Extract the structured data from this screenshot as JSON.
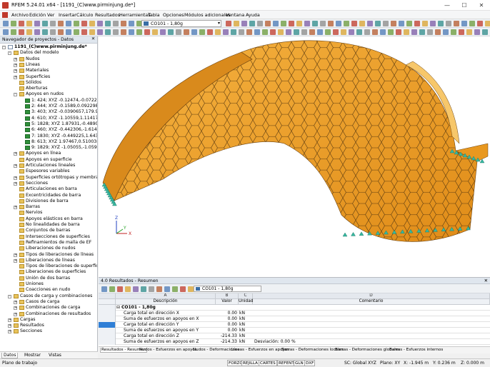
{
  "window": {
    "title": "RFEM 5.24.01 x64 - [1191_(C)www.pirminjung.de*]",
    "minimize": "—",
    "maximize": "☐",
    "close": "✕"
  },
  "menu": [
    "Archivo",
    "Edición",
    "Ver",
    "Insertar",
    "Cálculo",
    "Resultados",
    "Herramientas",
    "Tabla",
    "Opciones",
    "Módulos adicionales",
    "Ventana",
    "Ayuda"
  ],
  "toolbar": {
    "load_case": "CO101 - 1,80g"
  },
  "navigator": {
    "title": "Navegador de proyectos - Datos",
    "items": [
      {
        "label": "1191_(C)www.pirminjung.de*",
        "level": 0,
        "exp": "−",
        "icon": "file",
        "bold": true
      },
      {
        "label": "Datos del modelo",
        "level": 1,
        "exp": "−",
        "icon": "fold"
      },
      {
        "label": "Nudos",
        "level": 2,
        "exp": "+",
        "icon": "fold"
      },
      {
        "label": "Líneas",
        "level": 2,
        "exp": "+",
        "icon": "fold"
      },
      {
        "label": "Materiales",
        "level": 2,
        "exp": "+",
        "icon": "fold"
      },
      {
        "label": "Superficies",
        "level": 2,
        "exp": "+",
        "icon": "fold"
      },
      {
        "label": "Sólidos",
        "level": 2,
        "exp": "",
        "icon": "fold"
      },
      {
        "label": "Aberturas",
        "level": 2,
        "exp": "",
        "icon": "fold"
      },
      {
        "label": "Apoyos en nudos",
        "level": 2,
        "exp": "−",
        "icon": "fold"
      },
      {
        "label": "1: 424; XYZ -0.12474,-0.072279",
        "level": 3,
        "exp": "",
        "icon": "sup"
      },
      {
        "label": "2: 444; XYZ -0.1589,0.0922984,5",
        "level": 3,
        "exp": "",
        "icon": "sup"
      },
      {
        "label": "3: 403; XYZ -0.0390657,179.956 *",
        "level": 3,
        "exp": "",
        "icon": "sup"
      },
      {
        "label": "4: 610; XYZ -1.10559,1.11417,44",
        "level": 3,
        "exp": "",
        "icon": "sup"
      },
      {
        "label": "5: 1828; XYZ 1.87931,-0.489018,",
        "level": 3,
        "exp": "",
        "icon": "sup"
      },
      {
        "label": "6: 460; XYZ -0.442306,-1.61422,",
        "level": 3,
        "exp": "",
        "icon": "sup"
      },
      {
        "label": "7: 1830; XYZ -0.449225,1.64378,",
        "level": 3,
        "exp": "",
        "icon": "sup"
      },
      {
        "label": "8: 613; XYZ 1.97467,0.510038,-7",
        "level": 3,
        "exp": "",
        "icon": "sup"
      },
      {
        "label": "9: 1829; XYZ -1.05055,-1.05909,",
        "level": 3,
        "exp": "",
        "icon": "sup"
      },
      {
        "label": "Apoyos en línea",
        "level": 2,
        "exp": "+",
        "icon": "fold"
      },
      {
        "label": "Apoyos en superficie",
        "level": 2,
        "exp": "",
        "icon": "fold"
      },
      {
        "label": "Articulaciones lineales",
        "level": 2,
        "exp": "+",
        "icon": "fold"
      },
      {
        "label": "Espesores variables",
        "level": 2,
        "exp": "",
        "icon": "fold"
      },
      {
        "label": "Superficies ortótropas y membran",
        "level": 2,
        "exp": "+",
        "icon": "fold"
      },
      {
        "label": "Secciones",
        "level": 2,
        "exp": "+",
        "icon": "fold"
      },
      {
        "label": "Articulaciones en barra",
        "level": 2,
        "exp": "",
        "icon": "fold"
      },
      {
        "label": "Excentricidades de barra",
        "level": 2,
        "exp": "",
        "icon": "fold"
      },
      {
        "label": "Divisiones de barra",
        "level": 2,
        "exp": "",
        "icon": "fold"
      },
      {
        "label": "Barras",
        "level": 2,
        "exp": "+",
        "icon": "fold"
      },
      {
        "label": "Nervios",
        "level": 2,
        "exp": "",
        "icon": "fold"
      },
      {
        "label": "Apoyos elásticos en barra",
        "level": 2,
        "exp": "",
        "icon": "fold"
      },
      {
        "label": "No linealidades de barra",
        "level": 2,
        "exp": "",
        "icon": "fold"
      },
      {
        "label": "Conjuntos de barras",
        "level": 2,
        "exp": "",
        "icon": "fold"
      },
      {
        "label": "Intersecciones de superficies",
        "level": 2,
        "exp": "",
        "icon": "fold"
      },
      {
        "label": "Refinamientos de malla de EF",
        "level": 2,
        "exp": "",
        "icon": "fold"
      },
      {
        "label": "Liberaciones de nudos",
        "level": 2,
        "exp": "",
        "icon": "fold"
      },
      {
        "label": "Tipos de liberaciones de líneas",
        "level": 2,
        "exp": "+",
        "icon": "fold"
      },
      {
        "label": "Liberaciones de líneas",
        "level": 2,
        "exp": "+",
        "icon": "fold"
      },
      {
        "label": "Tipos de liberaciones de superficie",
        "level": 2,
        "exp": "",
        "icon": "fold"
      },
      {
        "label": "Liberaciones de superficies",
        "level": 2,
        "exp": "",
        "icon": "fold"
      },
      {
        "label": "Unión de dos barras",
        "level": 2,
        "exp": "",
        "icon": "fold"
      },
      {
        "label": "Uniones",
        "level": 2,
        "exp": "",
        "icon": "fold"
      },
      {
        "label": "Coacciones en nudo",
        "level": 2,
        "exp": "",
        "icon": "fold"
      },
      {
        "label": "Casos de carga y combinaciones",
        "level": 1,
        "exp": "−",
        "icon": "fold"
      },
      {
        "label": "Casos de carga",
        "level": 2,
        "exp": "+",
        "icon": "fold"
      },
      {
        "label": "Combinaciones de carga",
        "level": 2,
        "exp": "+",
        "icon": "fold"
      },
      {
        "label": "Combinaciones de resultados",
        "level": 2,
        "exp": "+",
        "icon": "fold"
      },
      {
        "label": "Cargas",
        "level": 1,
        "exp": "+",
        "icon": "fold"
      },
      {
        "label": "Resultados",
        "level": 1,
        "exp": "+",
        "icon": "fold"
      },
      {
        "label": "Secciones",
        "level": 1,
        "exp": "+",
        "icon": "fold"
      }
    ],
    "tabs": [
      "Datos",
      "Mostrar",
      "Vistas"
    ]
  },
  "results": {
    "title": "4.0 Resultados - Resumen",
    "load_case": "CO101 - 1,80g",
    "col_letters": [
      "A",
      "B",
      "C",
      "D"
    ],
    "col_headers": [
      "Descripción",
      "Valor",
      "Unidad",
      "Comentario"
    ],
    "group": "CO101 - 1,80g",
    "rows": [
      {
        "desc": "Carga total en dirección X",
        "val": "0.00",
        "unit": "kN",
        "comment": ""
      },
      {
        "desc": "Suma de esfuerzos en apoyos en X",
        "val": "0.00",
        "unit": "kN",
        "comment": ""
      },
      {
        "desc": "Carga total en dirección Y",
        "val": "0.00",
        "unit": "kN",
        "comment": ""
      },
      {
        "desc": "Suma de esfuerzos en apoyos en Y",
        "val": "0.00",
        "unit": "kN",
        "comment": ""
      },
      {
        "desc": "Carga total en dirección Z",
        "val": "-214.33",
        "unit": "kN",
        "comment": ""
      },
      {
        "desc": "Suma de esfuerzos en apoyos en Z",
        "val": "-214.33",
        "unit": "kN",
        "comment": "Desviación: 0.00 %"
      }
    ],
    "tabs": [
      "Resultados - Resumen",
      "Nudos - Esfuerzos en apoyos",
      "Nudos - Deformaciones",
      "Líneas - Esfuerzos en apoyos",
      "Barras - Deformaciones locales",
      "Barras - Deformaciones globales",
      "Barras - Esfuerzos internos"
    ]
  },
  "axes": {
    "x": "X",
    "y": "Y",
    "z": "Z"
  },
  "status": {
    "left": "Plano de trabajo",
    "buttons": [
      "FORZC",
      "REJILLA",
      "CARTES",
      "REFENT",
      "GLN",
      "DXF"
    ],
    "sc": "SC: Global XYZ",
    "plane": "Plano: XY",
    "x": "X: -1.945 m",
    "y": "Y: 0.236 m",
    "z": "Z: 0.000 m"
  },
  "colors": {
    "shell": "#f0a02a",
    "shell_dark": "#c97d14",
    "support": "#36b8a0"
  }
}
